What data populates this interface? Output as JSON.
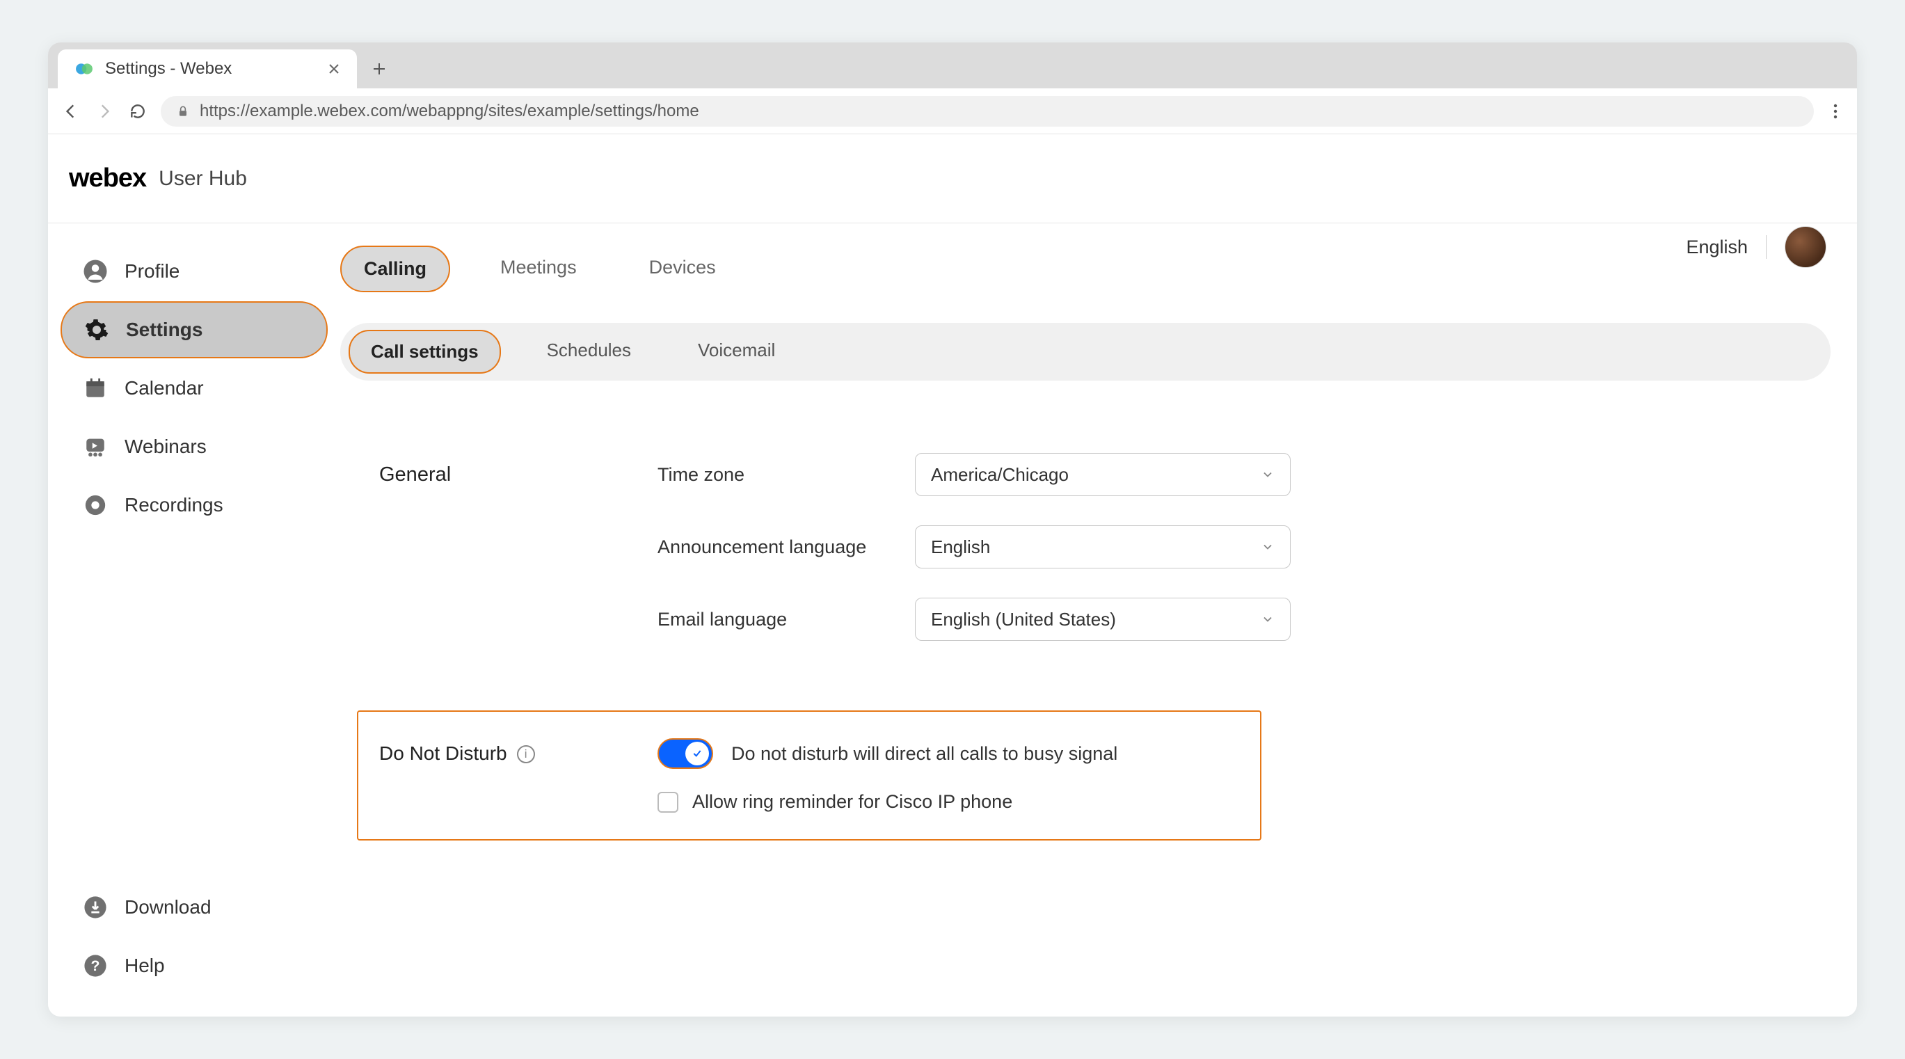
{
  "browser": {
    "tab_title": "Settings - Webex",
    "url": "https://example.webex.com/webappng/sites/example/settings/home"
  },
  "header": {
    "logo": "webex",
    "hub": "User Hub"
  },
  "sidebar": {
    "items": [
      {
        "label": "Profile"
      },
      {
        "label": "Settings"
      },
      {
        "label": "Calendar"
      },
      {
        "label": "Webinars"
      },
      {
        "label": "Recordings"
      }
    ],
    "bottom": [
      {
        "label": "Download"
      },
      {
        "label": "Help"
      }
    ]
  },
  "top_right": {
    "language": "English"
  },
  "primary_tabs": [
    {
      "label": "Calling"
    },
    {
      "label": "Meetings"
    },
    {
      "label": "Devices"
    }
  ],
  "sub_tabs": [
    {
      "label": "Call settings"
    },
    {
      "label": "Schedules"
    },
    {
      "label": "Voicemail"
    }
  ],
  "general": {
    "section": "General",
    "timezone_label": "Time zone",
    "timezone_value": "America/Chicago",
    "announcement_label": "Announcement language",
    "announcement_value": "English",
    "email_lang_label": "Email language",
    "email_lang_value": "English (United States)"
  },
  "dnd": {
    "title": "Do Not Disturb",
    "description": "Do not disturb will direct all calls to busy signal",
    "checkbox_label": "Allow ring reminder for Cisco IP phone"
  }
}
